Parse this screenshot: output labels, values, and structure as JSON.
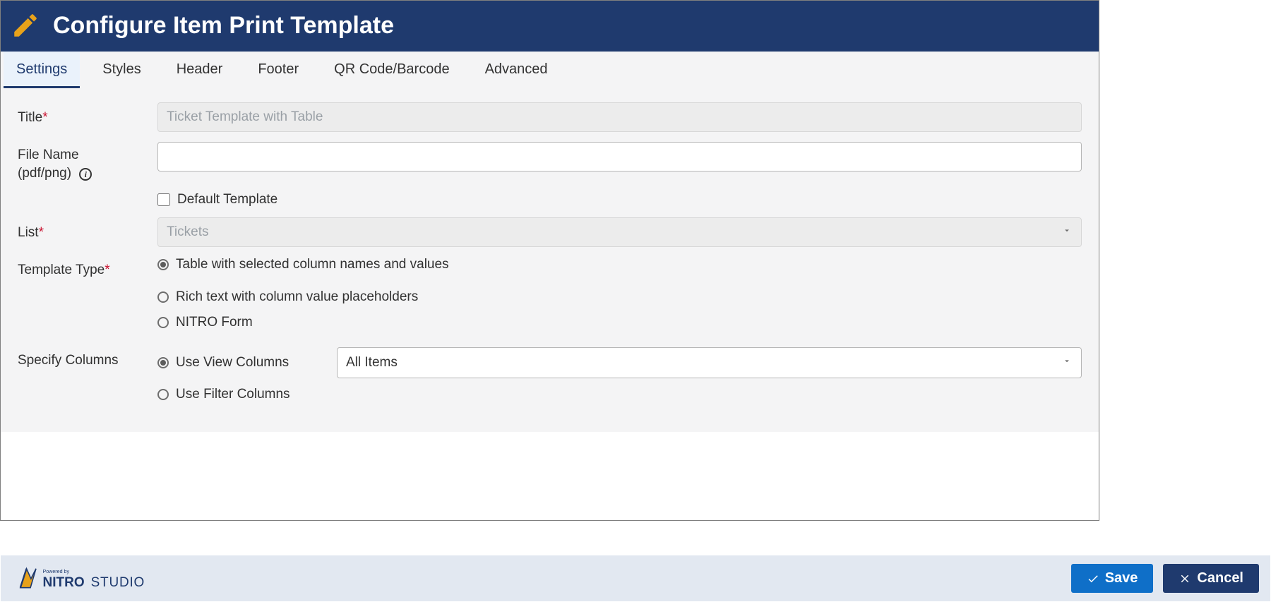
{
  "header": {
    "title": "Configure Item Print Template"
  },
  "tabs": [
    {
      "label": "Settings",
      "active": true
    },
    {
      "label": "Styles",
      "active": false
    },
    {
      "label": "Header",
      "active": false
    },
    {
      "label": "Footer",
      "active": false
    },
    {
      "label": "QR Code/Barcode",
      "active": false
    },
    {
      "label": "Advanced",
      "active": false
    }
  ],
  "fields": {
    "title": {
      "label": "Title",
      "required_marker": "*",
      "placeholder": "Ticket Template with Table",
      "value": ""
    },
    "filename": {
      "label_line1": "File Name",
      "label_line2": "(pdf/png)",
      "value": ""
    },
    "default_template": {
      "label": "Default Template",
      "checked": false
    },
    "list": {
      "label": "List",
      "required_marker": "*",
      "value": "Tickets"
    },
    "template_type": {
      "label": "Template Type",
      "required_marker": "*",
      "options": [
        {
          "label": "Table with selected column names and values",
          "selected": true
        },
        {
          "label": "Rich text with column value placeholders",
          "selected": false
        },
        {
          "label": "NITRO Form",
          "selected": false
        }
      ]
    },
    "specify_columns": {
      "label": "Specify Columns",
      "options": [
        {
          "label": "Use View Columns",
          "selected": true
        },
        {
          "label": "Use Filter Columns",
          "selected": false
        }
      ],
      "view_select_value": "All Items"
    }
  },
  "footer": {
    "powered_by": "Powered by",
    "brand_bold": "NITRO",
    "brand_light": "STUDIO",
    "save": "Save",
    "cancel": "Cancel"
  }
}
